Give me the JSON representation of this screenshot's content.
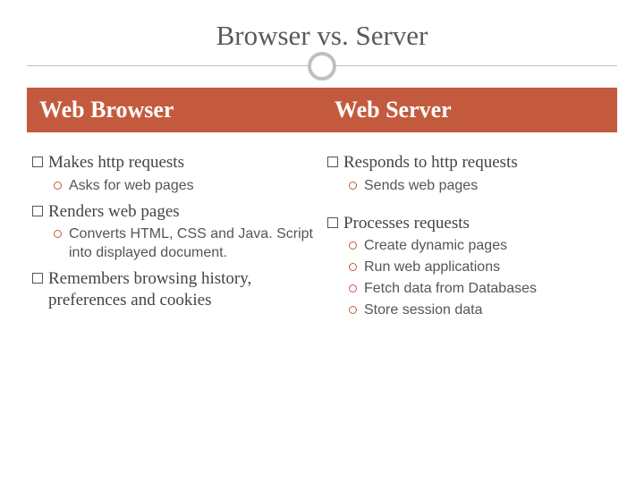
{
  "title": "Browser vs. Server",
  "left": {
    "heading": "Web Browser",
    "items": [
      {
        "text": "Makes http requests",
        "sub": [
          "Asks for web pages"
        ]
      },
      {
        "text": "Renders web pages",
        "sub": [
          "Converts HTML, CSS and Java. Script into displayed document."
        ]
      },
      {
        "text": "Remembers browsing history, preferences and cookies",
        "sub": []
      }
    ]
  },
  "right": {
    "heading": "Web Server",
    "items": [
      {
        "text": "Responds to http requests",
        "sub": [
          "Sends web pages"
        ]
      },
      {
        "text": "Processes requests",
        "sub": [
          "Create dynamic pages",
          "Run web applications",
          "Fetch data from Databases",
          "Store session data"
        ]
      }
    ]
  }
}
